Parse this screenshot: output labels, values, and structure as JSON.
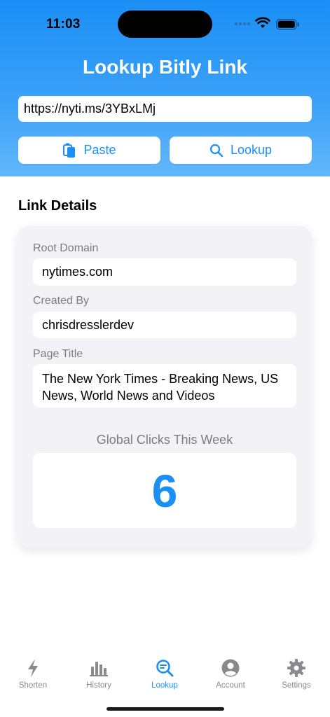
{
  "status_bar": {
    "time": "11:03"
  },
  "header": {
    "title": "Lookup Bitly Link",
    "url_value": "https://nyti.ms/3YBxLMj",
    "paste_label": "Paste",
    "lookup_label": "Lookup"
  },
  "details": {
    "section_title": "Link Details",
    "root_domain_label": "Root Domain",
    "root_domain_value": "nytimes.com",
    "created_by_label": "Created By",
    "created_by_value": "chrisdresslerdev",
    "page_title_label": "Page Title",
    "page_title_value": "The New York Times - Breaking News, US News, World News and Videos",
    "clicks_label": "Global Clicks This Week",
    "clicks_value": "6"
  },
  "tabbar": {
    "items": [
      {
        "label": "Shorten",
        "icon": "bolt-icon"
      },
      {
        "label": "History",
        "icon": "bar-chart-icon"
      },
      {
        "label": "Lookup",
        "icon": "search-icon",
        "active": true
      },
      {
        "label": "Account",
        "icon": "person-circle-icon"
      },
      {
        "label": "Settings",
        "icon": "gear-icon"
      }
    ]
  },
  "colors": {
    "accent": "#1a8ff6",
    "header_top": "#1a8ff6",
    "header_bottom": "#62b7fb",
    "card_bg": "#f2f2f7"
  }
}
